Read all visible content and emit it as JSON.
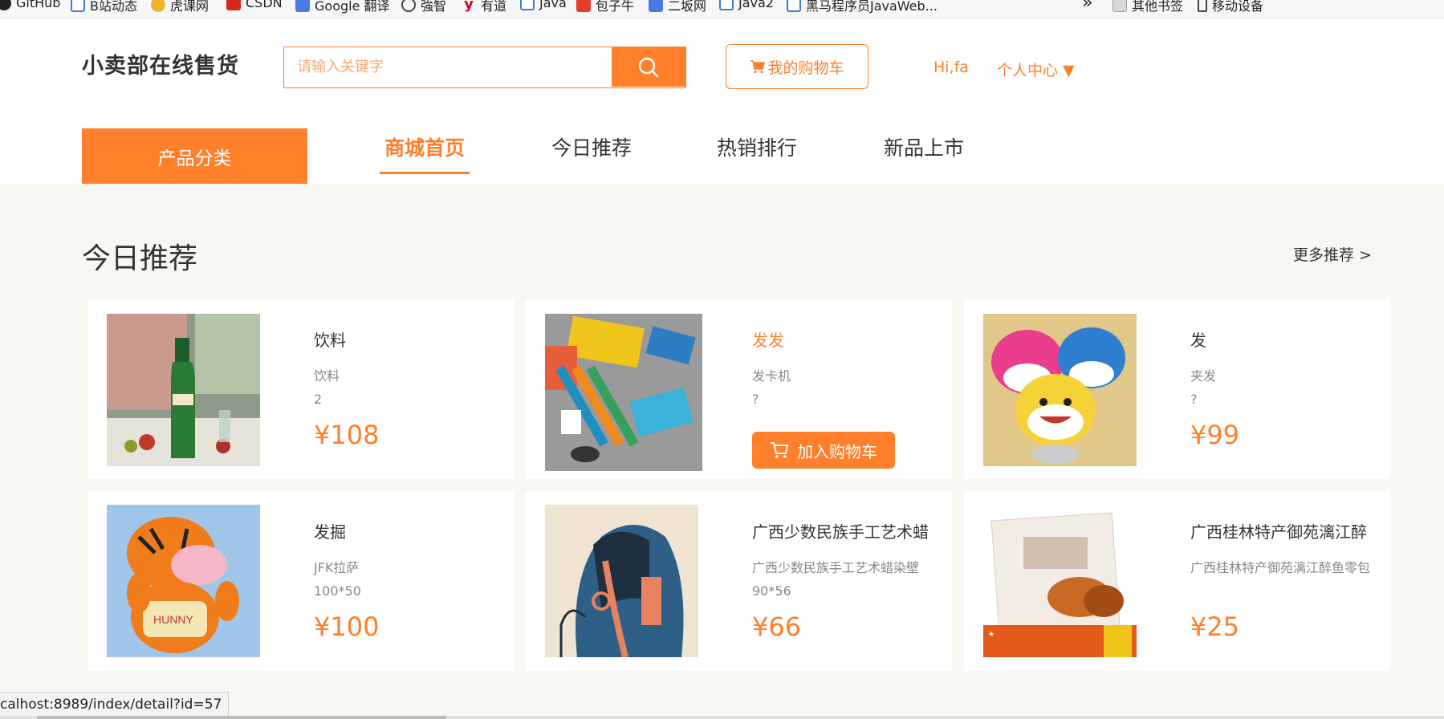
{
  "bookmarks": [
    {
      "label": "GitHub",
      "icon": "github-icon"
    },
    {
      "label": "B站动态",
      "icon": "bilibili-icon"
    },
    {
      "label": "虎课网",
      "icon": "huke-icon"
    },
    {
      "label": "CSDN",
      "icon": "csdn-icon"
    },
    {
      "label": "Google 翻译",
      "icon": "google-translate-icon"
    },
    {
      "label": "強智",
      "icon": "globe-icon"
    },
    {
      "label": "有道",
      "icon": "youdao-icon"
    },
    {
      "label": "Java",
      "icon": "bilibili-icon"
    },
    {
      "label": "包子牛",
      "icon": "cainiao-icon"
    },
    {
      "label": "二坂网",
      "icon": "erban-icon"
    },
    {
      "label": "Java2",
      "icon": "bilibili-icon"
    },
    {
      "label": "黑马程序员JavaWeb...",
      "icon": "bilibili-icon"
    },
    {
      "label": "其他书签",
      "icon": "folder-icon"
    },
    {
      "label": "移动设备",
      "icon": "mobile-icon"
    }
  ],
  "header": {
    "logo": "小卖部在线售货",
    "search_placeholder": "请输入关键字",
    "cart_label": "我的购物车",
    "greeting": "Hi,fa",
    "personal_center": "个人中心 ▼"
  },
  "nav": {
    "category_label": "产品分类",
    "tabs": [
      "商城首页",
      "今日推荐",
      "热销排行",
      "新品上市"
    ]
  },
  "section": {
    "title": "今日推荐",
    "more": "更多推荐 >"
  },
  "products": [
    {
      "name": "饮料",
      "desc": "饮料",
      "spec": "2",
      "price": "¥108",
      "image": "green-bottle"
    },
    {
      "name": "发发",
      "desc": "发卡机",
      "spec": "?",
      "price": "",
      "add_to_cart": "加入购物车",
      "image": "stationery"
    },
    {
      "name": "发",
      "desc": "夹发",
      "spec": "?",
      "price": "¥99",
      "image": "shark-plush"
    },
    {
      "name": "发掘",
      "desc": "JFK拉萨",
      "spec": "100*50",
      "price": "¥100",
      "image": "tiger-plush"
    },
    {
      "name": "广西少数民族手工艺术蜡",
      "desc": "广西少数民族手工艺术蜡染壁",
      "spec": "90*56",
      "price": "¥66",
      "image": "batik-painting"
    },
    {
      "name": "广西桂林特产御苑漓江醉",
      "desc": "广西桂林特产御苑漓江醉鱼零包",
      "spec": "",
      "price": "¥25",
      "image": "fish-snack-package"
    }
  ],
  "status_url": "calhost:8989/index/detail?id=57",
  "colors": {
    "accent": "#ff7f2a",
    "background": "#f9f7f2"
  }
}
